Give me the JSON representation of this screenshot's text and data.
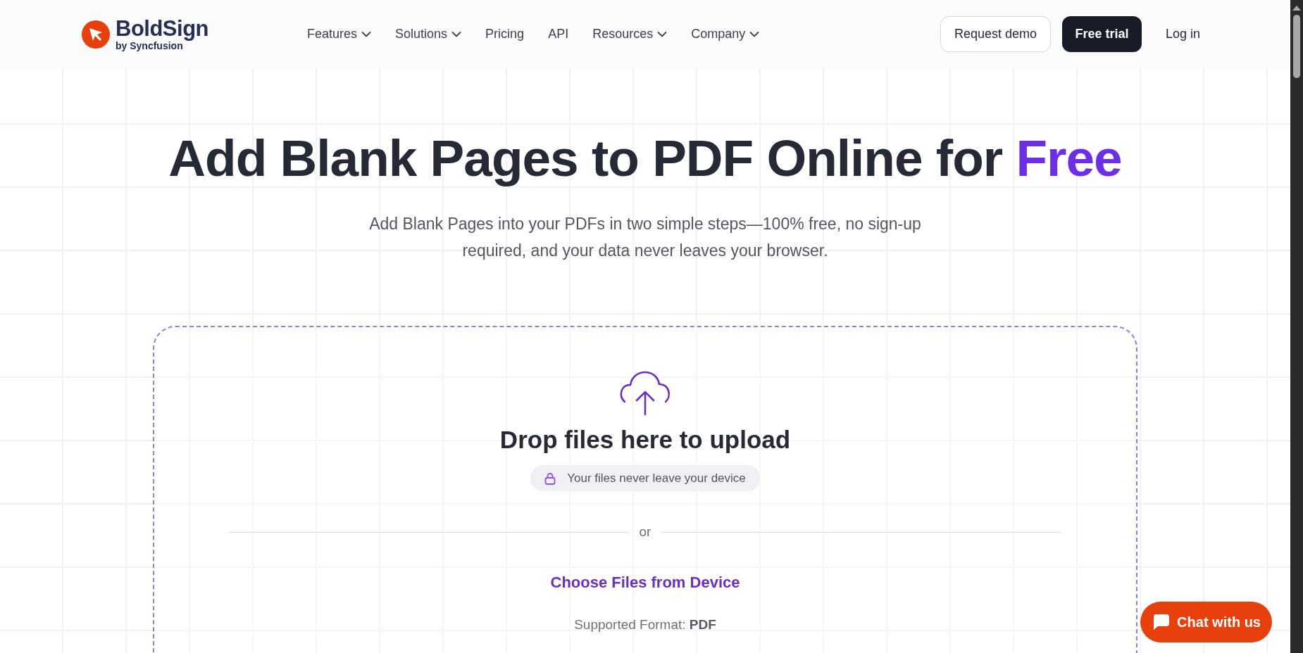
{
  "header": {
    "logo": {
      "name": "BoldSign",
      "tagline": "by Syncfusion"
    },
    "nav": [
      {
        "label": "Features",
        "has_menu": true
      },
      {
        "label": "Solutions",
        "has_menu": true
      },
      {
        "label": "Pricing",
        "has_menu": false
      },
      {
        "label": "API",
        "has_menu": false
      },
      {
        "label": "Resources",
        "has_menu": true
      },
      {
        "label": "Company",
        "has_menu": true
      }
    ],
    "actions": [
      {
        "label": "Request demo",
        "kind": "outline"
      },
      {
        "label": "Free trial",
        "kind": "primary"
      },
      {
        "label": "Log in",
        "kind": "text"
      }
    ]
  },
  "hero": {
    "title": [
      {
        "text": "Add Blank Pages to PDF Online for ",
        "highlight": false
      },
      {
        "text": "Free",
        "highlight": true
      }
    ],
    "subtitle": "Add Blank Pages into your PDFs in two simple steps—100% free, no sign-up required, and your data never leaves your browser."
  },
  "upload": {
    "heading": "Drop files here to upload",
    "privacy_note": "Your files never leave your device",
    "divider_text": "or",
    "choose_link": "Choose Files from Device",
    "supported": "Supported Format: **PDF**"
  },
  "chat": {
    "label": "Chat with us"
  }
}
